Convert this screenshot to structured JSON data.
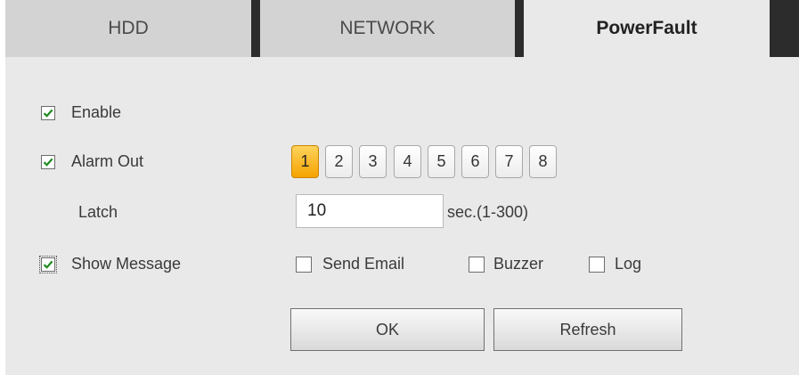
{
  "tabs": [
    {
      "label": "HDD"
    },
    {
      "label": "NETWORK"
    },
    {
      "label": "PowerFault"
    }
  ],
  "form": {
    "enable": {
      "label": "Enable",
      "checked": true
    },
    "alarm_out": {
      "label": "Alarm Out",
      "checked": true,
      "channels": [
        "1",
        "2",
        "3",
        "4",
        "5",
        "6",
        "7",
        "8"
      ],
      "selected": "1"
    },
    "latch": {
      "label": "Latch",
      "value": "10",
      "unit": "sec.(1-300)"
    },
    "show_message": {
      "label": "Show Message",
      "checked": true
    },
    "send_email": {
      "label": "Send Email",
      "checked": false
    },
    "buzzer": {
      "label": "Buzzer",
      "checked": false
    },
    "log": {
      "label": "Log",
      "checked": false
    }
  },
  "buttons": {
    "ok": "OK",
    "refresh": "Refresh"
  },
  "colors": {
    "selected_channel": "#f5a300",
    "check_mark": "#1f8a1f",
    "tab_separator": "#2c2c2c"
  },
  "icons": {
    "check": "check-mark-icon"
  }
}
